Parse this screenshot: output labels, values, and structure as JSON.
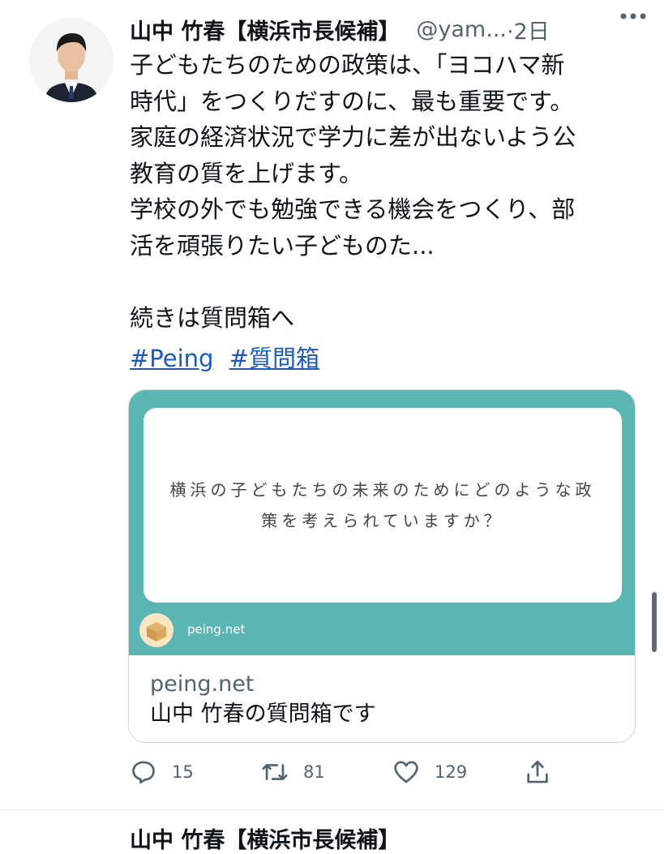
{
  "tweet": {
    "author_name": "山中 竹春【横浜市長候補】",
    "handle": "@yam...",
    "time": "·2日",
    "body_lines": [
      "子どもたちのための政策は、「ヨコハマ新",
      "時代」をつくりだすのに、最も重要です。",
      "家庭の経済状況で学力に差が出ないよう公",
      "教育の質を上げます。",
      "学校の外でも勉強できる機会をつくり、部",
      "活を頑張りたい子どものた...",
      "",
      "続きは質問箱へ"
    ],
    "hashtags": [
      "#Peing",
      "#質問箱"
    ],
    "more_icon": "more-horizontal-icon"
  },
  "card": {
    "question": "横浜の子どもたちの未来のためにどのような政策を考えられていますか？",
    "media_source": "peing.net",
    "domain": "peing.net",
    "title": "山中 竹春の質問箱です",
    "media_bg": "#5bb5b2"
  },
  "actions": {
    "reply_count": "15",
    "retweet_count": "81",
    "like_count": "129"
  },
  "next_tweet": {
    "author_name": "山中 竹春【横浜市長候補】"
  },
  "colors": {
    "text": "#0f1419",
    "secondary": "#536471",
    "link": "#1d5bb8",
    "border": "#cfd9de"
  }
}
